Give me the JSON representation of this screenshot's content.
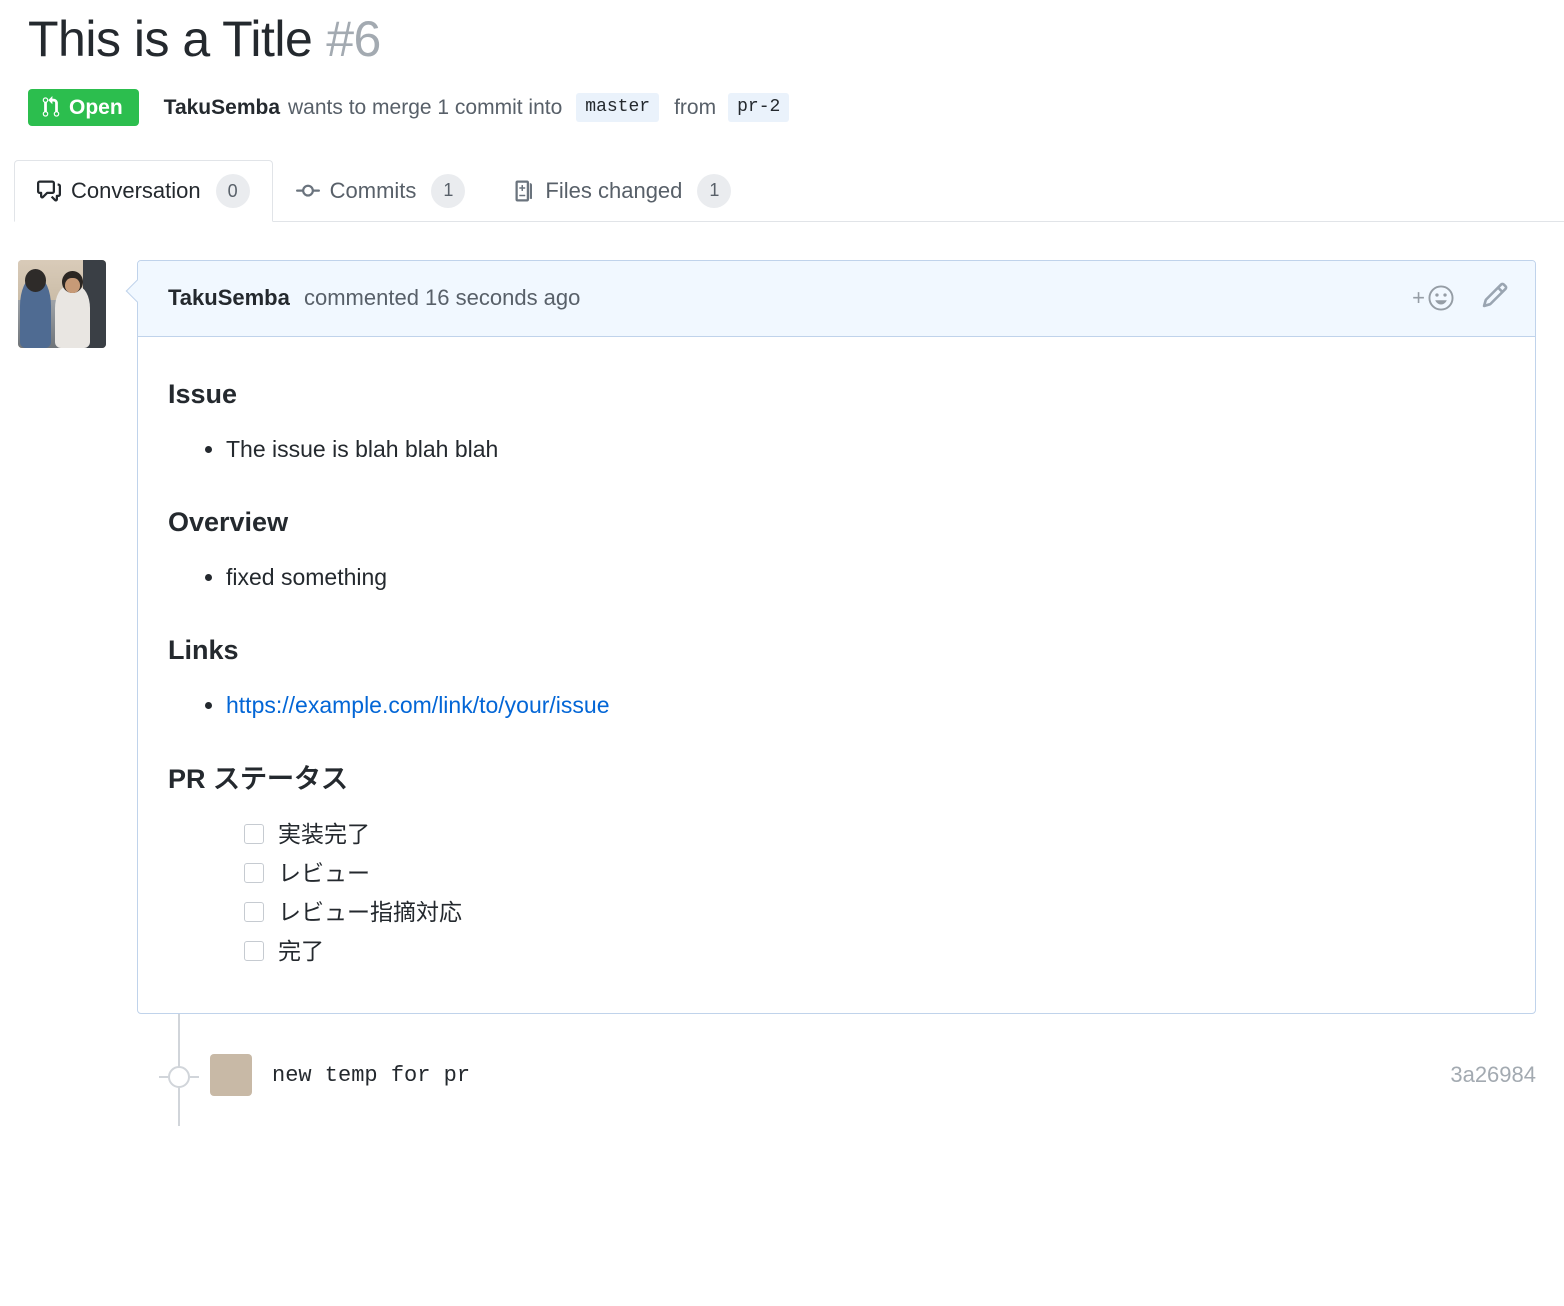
{
  "header": {
    "title": "This is a Title",
    "number": "#6",
    "state_label": "Open",
    "state_color": "#2cbe4e",
    "state_icon": "git-pull-request-icon",
    "author": "TakuSemba",
    "merge_text_1": "wants to merge 1 commit into",
    "base_branch": "master",
    "merge_text_2": "from",
    "head_branch": "pr-2"
  },
  "tabs": [
    {
      "label": "Conversation",
      "count": "0",
      "icon": "comment-discussion-icon",
      "active": true
    },
    {
      "label": "Commits",
      "count": "1",
      "icon": "git-commit-icon",
      "active": false
    },
    {
      "label": "Files changed",
      "count": "1",
      "icon": "diff-icon",
      "active": false
    }
  ],
  "comment": {
    "author": "TakuSemba",
    "meta": "commented 16 seconds ago",
    "reaction_icon": "add-reaction-smiley-icon",
    "reaction_plus": "+",
    "edit_icon": "pencil-icon",
    "sections": [
      {
        "heading": "Issue",
        "items": [
          "The issue is blah blah blah"
        ]
      },
      {
        "heading": "Overview",
        "items": [
          "fixed something"
        ]
      },
      {
        "heading": "Links",
        "items": [
          "https://example.com/link/to/your/issue"
        ],
        "link": true
      }
    ],
    "status_heading": "PR ステータス",
    "tasks": [
      {
        "label": "実装完了",
        "checked": false
      },
      {
        "label": "レビュー",
        "checked": false
      },
      {
        "label": "レビュー指摘対応",
        "checked": false
      },
      {
        "label": "完了",
        "checked": false
      }
    ]
  },
  "timeline": {
    "commit_message": "new temp for pr",
    "commit_sha": "3a26984"
  },
  "colors": {
    "accent_link": "#0366d6",
    "open_green": "#2cbe4e",
    "comment_header_bg": "#f1f8ff",
    "comment_border": "#c0d3eb",
    "branch_tag_bg": "#eaf2fb"
  }
}
